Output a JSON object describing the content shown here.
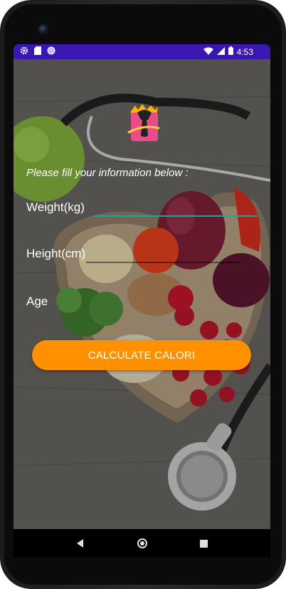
{
  "status_bar": {
    "time": "4:53",
    "icons_left": [
      "gear-icon",
      "sd-card-icon",
      "circle-icon"
    ],
    "icons_right": [
      "wifi-icon",
      "signal-icon",
      "battery-icon"
    ],
    "color": "#3a16b3"
  },
  "form": {
    "hint": "Please fill your information below :",
    "weight_label": "Weight(kg)",
    "height_label": "Height(cm)",
    "age_label": "Age",
    "calculate_label": "CALCULATE CALORI"
  },
  "colors": {
    "accent_button": "#ff9100",
    "focus_underline": "#1fa3a0"
  },
  "nav_bar": {
    "buttons": [
      "back-icon",
      "home-icon",
      "recents-icon"
    ]
  }
}
